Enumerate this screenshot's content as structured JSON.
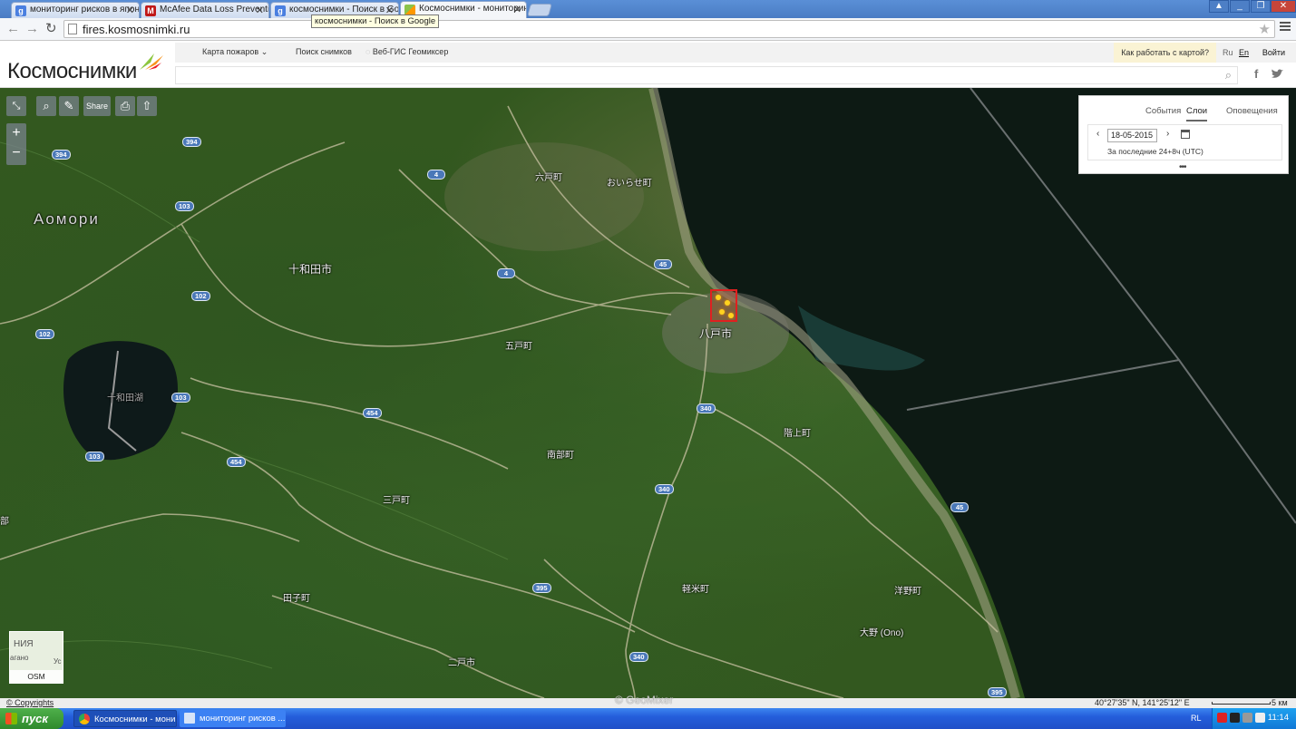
{
  "browser": {
    "tabs": [
      {
        "title": "мониторинг рисков в япони",
        "icon": "g"
      },
      {
        "title": "McAfee Data Loss Prevention",
        "icon": "m"
      },
      {
        "title": "космоснимки - Поиск в Goo",
        "icon": "g"
      },
      {
        "title": "Космоснимки - мониторинг",
        "icon": "k"
      }
    ],
    "tooltip": "космоснимки - Поиск в Google",
    "url": "fires.kosmosnimki.ru"
  },
  "site": {
    "logo": "Космоснимки",
    "nav": [
      "Карта пожаров",
      "Поиск снимков",
      "Веб-ГИС Геомиксер"
    ],
    "howto": "Как работать с картой?",
    "lang_ru": "Ru",
    "lang_en": "En",
    "login": "Войти",
    "social_facebook": "f",
    "social_twitter": "t"
  },
  "map_controls": {
    "share": "Share",
    "zoom_in": "+",
    "zoom_out": "−"
  },
  "panel": {
    "tabs": [
      "События",
      "Слои",
      "Оповещения"
    ],
    "active_tab": "Слои",
    "date": "18-05-2015",
    "period": "За последние 24+8ч (UTC)",
    "more": "•••"
  },
  "map_labels": {
    "region": "Аомори",
    "towada_city": "十和田市",
    "rokunohe": "六戸町",
    "oirase": "おいらせ町",
    "hachinohe": "八戸市",
    "gonohe": "五戸町",
    "lake_towada": "十和田湖",
    "nanbu": "南部町",
    "hashikami": "階上町",
    "sannohe": "三戸町",
    "takko": "田子町",
    "karumai": "軽米町",
    "hirono": "洋野町",
    "ono": "大野 (Ono)",
    "ninohe": "二戸市",
    "edge_left": "部"
  },
  "road_shields": [
    "394",
    "394",
    "103",
    "102",
    "102",
    "103",
    "103",
    "4",
    "4",
    "45",
    "454",
    "454",
    "340",
    "340",
    "340",
    "395",
    "45",
    "395"
  ],
  "minimap": {
    "label": "OSM",
    "text_top": "НИЯ",
    "text_left": "агано",
    "text_right": "Ус"
  },
  "status": {
    "copyright": "© Copyrights",
    "watermark": "© GeoMixer",
    "coords": "40°27'35\" N, 141°25'12\" E",
    "scale": "5 км"
  },
  "taskbar": {
    "start": "пуск",
    "items": [
      "Космоснимки - мони...",
      "мониторинг рисков ..."
    ],
    "lang": "RL",
    "clock": "11:14"
  }
}
